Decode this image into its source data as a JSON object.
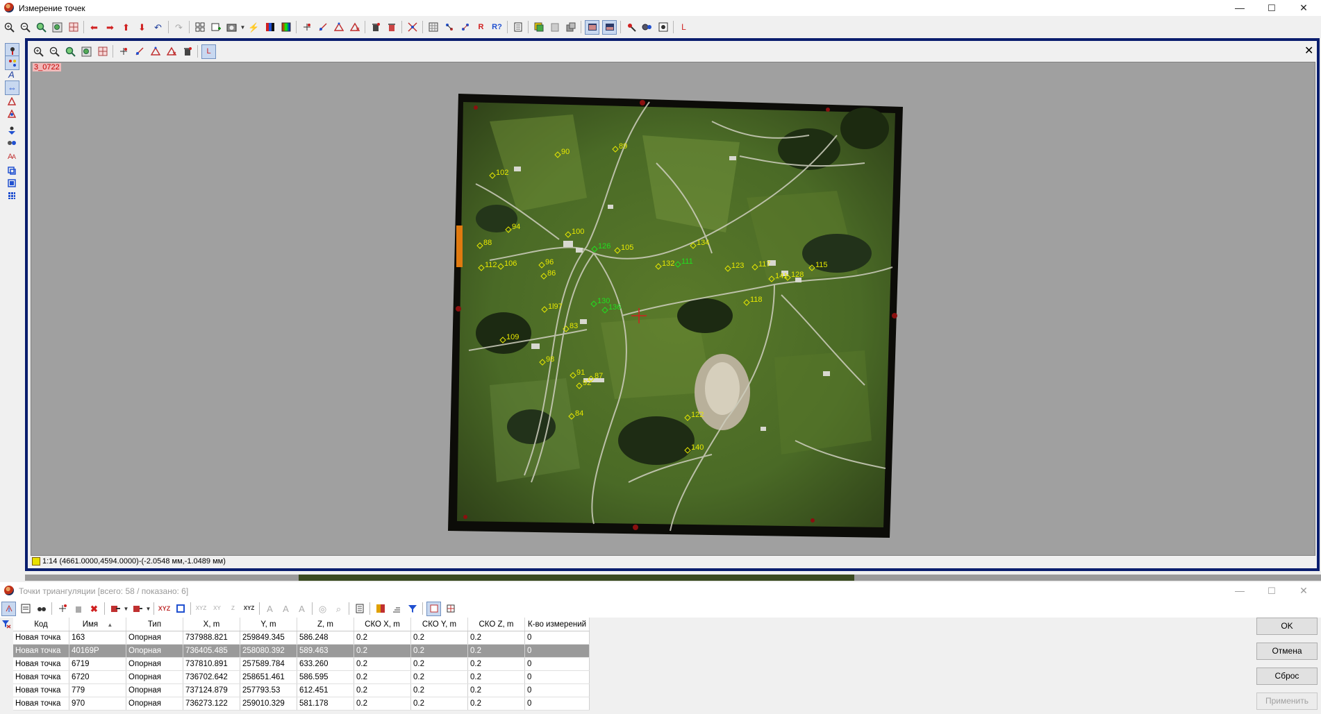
{
  "main_window": {
    "title": "Измерение точек",
    "minimize": "—",
    "maximize": "☐",
    "close": "✕"
  },
  "main_toolbar_icons": [
    "zoom-in-icon",
    "zoom-out-icon",
    "zoom-fit-icon",
    "zoom-window-icon",
    "grid-icon",
    "arrow-left-icon",
    "arrow-right-icon",
    "arrow-up-icon",
    "arrow-down-icon",
    "undo-icon",
    "redo-icon",
    "tile-icon",
    "add-frame-icon",
    "settings-icon",
    "lightning-icon",
    "color-bars-icon",
    "spectrum-icon",
    "add-point-icon",
    "measure-point-icon",
    "triangle-point-icon",
    "delete-point-icon",
    "clear-icon",
    "erase-icon",
    "tie-points-icon",
    "grid-points-icon",
    "auto-points-icon",
    "r-icon",
    "r-question-icon",
    "report-icon",
    "layers-icon",
    "copy-icon",
    "compare-icon",
    "view-single-icon",
    "view-double-icon",
    "zoom-tool-icon",
    "gear-tool-icon",
    "block-icon",
    "l-icon"
  ],
  "image_window": {
    "label": "3_0722",
    "close": "✕",
    "status": "1:14 (4661.0000,4594.0000)-(-2.0548 мм,-1.0489 мм)",
    "toolbar_l": "L"
  },
  "left_toolbar_letter": "A",
  "main_toolbar_r": "R",
  "main_toolbar_l": "L",
  "measured_points": [
    {
      "id": "90",
      "color": "#e8e800"
    },
    {
      "id": "89",
      "color": "#e8e800"
    },
    {
      "id": "102",
      "color": "#e8e800"
    },
    {
      "id": "94",
      "color": "#e8e800"
    },
    {
      "id": "100",
      "color": "#e8e800"
    },
    {
      "id": "88",
      "color": "#e8e800"
    },
    {
      "id": "126",
      "color": "#20e020"
    },
    {
      "id": "105",
      "color": "#e8e800"
    },
    {
      "id": "134",
      "color": "#e8e800"
    },
    {
      "id": "112",
      "color": "#e8e800"
    },
    {
      "id": "106",
      "color": "#e8e800"
    },
    {
      "id": "96",
      "color": "#e8e800"
    },
    {
      "id": "86",
      "color": "#e8e800"
    },
    {
      "id": "132",
      "color": "#e8e800"
    },
    {
      "id": "111",
      "color": "#20e020"
    },
    {
      "id": "123",
      "color": "#e8e800"
    },
    {
      "id": "117",
      "color": "#e8e800"
    },
    {
      "id": "115",
      "color": "#e8e800"
    },
    {
      "id": "141",
      "color": "#e8e800"
    },
    {
      "id": "128",
      "color": "#e8e800"
    },
    {
      "id": "118",
      "color": "#e8e800"
    },
    {
      "id": "130",
      "color": "#20e020"
    },
    {
      "id": "136",
      "color": "#20e020"
    },
    {
      "id": "1l97",
      "color": "#e8e800"
    },
    {
      "id": "83",
      "color": "#e8e800"
    },
    {
      "id": "109",
      "color": "#e8e800"
    },
    {
      "id": "98",
      "color": "#e8e800"
    },
    {
      "id": "91",
      "color": "#e8e800"
    },
    {
      "id": "92",
      "color": "#e8e800"
    },
    {
      "id": "87",
      "color": "#e8e800"
    },
    {
      "id": "84",
      "color": "#e8e800"
    },
    {
      "id": "122",
      "color": "#e8e800"
    },
    {
      "id": "140",
      "color": "#e8e800"
    }
  ],
  "triangulation_window": {
    "title": "Точки триангуляции [всего: 58 / показано: 6]",
    "minimize": "—",
    "maximize": "☐",
    "close": "✕",
    "columns": [
      "Код",
      "Имя",
      "Тип",
      "X, m",
      "Y, m",
      "Z, m",
      "СКО X, m",
      "СКО Y, m",
      "СКО Z, m",
      "К-во измерений"
    ],
    "sort_indicator": "▲",
    "rows": [
      [
        "Новая точка",
        "163",
        "Опорная",
        "737988.821",
        "259849.345",
        "586.248",
        "0.2",
        "0.2",
        "0.2",
        "0"
      ],
      [
        "Новая точка",
        "40169P",
        "Опорная",
        "736405.485",
        "258080.392",
        "589.463",
        "0.2",
        "0.2",
        "0.2",
        "0"
      ],
      [
        "Новая точка",
        "6719",
        "Опорная",
        "737810.891",
        "257589.784",
        "633.260",
        "0.2",
        "0.2",
        "0.2",
        "0"
      ],
      [
        "Новая точка",
        "6720",
        "Опорная",
        "736702.642",
        "258651.461",
        "586.595",
        "0.2",
        "0.2",
        "0.2",
        "0"
      ],
      [
        "Новая точка",
        "779",
        "Опорная",
        "737124.879",
        "257793.53",
        "612.451",
        "0.2",
        "0.2",
        "0.2",
        "0"
      ],
      [
        "Новая точка",
        "970",
        "Опорная",
        "736273.122",
        "259010.329",
        "581.178",
        "0.2",
        "0.2",
        "0.2",
        "0"
      ]
    ],
    "selected_row": 1,
    "buttons": {
      "ok": "OK",
      "cancel": "Отмена",
      "reset": "Сброс",
      "apply": "Применить"
    }
  }
}
